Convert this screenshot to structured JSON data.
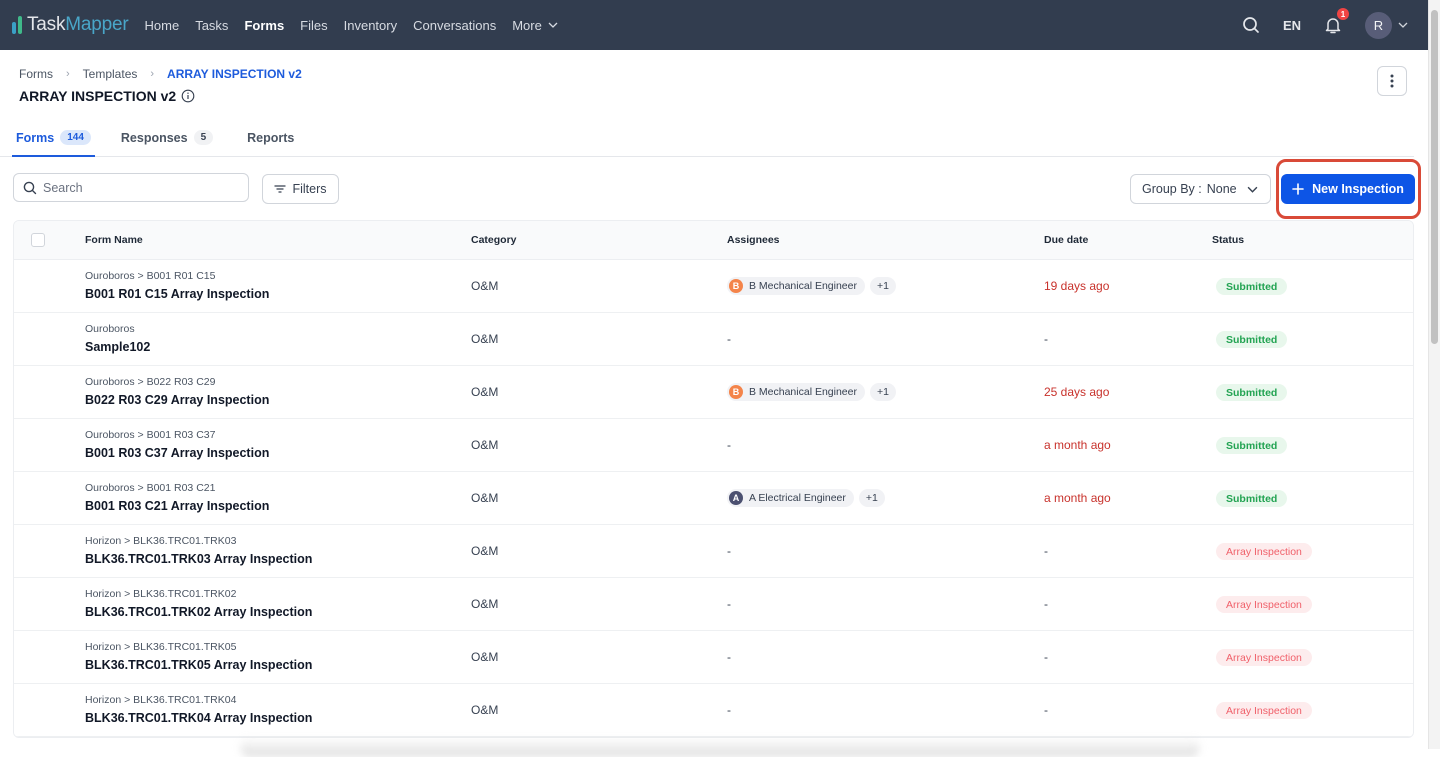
{
  "app": {
    "logo_part1": "Task",
    "logo_part2": "Mapper",
    "nav": [
      {
        "label": "Home",
        "active": false
      },
      {
        "label": "Tasks",
        "active": false
      },
      {
        "label": "Forms",
        "active": true
      },
      {
        "label": "Files",
        "active": false
      },
      {
        "label": "Inventory",
        "active": false
      },
      {
        "label": "Conversations",
        "active": false
      },
      {
        "label": "More",
        "active": false,
        "has_dropdown": true
      }
    ],
    "language": "EN",
    "notification_count": "1",
    "user_initial": "R",
    "icons": {
      "search": "search-icon",
      "bell": "bell-icon",
      "chevron": "chevron-down-icon"
    }
  },
  "breadcrumb": [
    {
      "label": "Forms"
    },
    {
      "label": "Templates"
    },
    {
      "label": "ARRAY INSPECTION v2",
      "current": true
    }
  ],
  "page": {
    "title": "ARRAY INSPECTION v2"
  },
  "tabs": [
    {
      "label": "Forms",
      "count": "144",
      "active": true
    },
    {
      "label": "Responses",
      "count": "5",
      "active": false
    },
    {
      "label": "Reports",
      "count": null,
      "active": false
    }
  ],
  "toolbar": {
    "search_placeholder": "Search",
    "search_value": "",
    "filters_label": "Filters",
    "group_by_label": "Group By :",
    "group_by_value": "None",
    "new_button_label": "New Inspection"
  },
  "colors": {
    "nav_bg": "#323d4f",
    "accent": "#0d55e6",
    "overdue": "#c8322c",
    "submitted_fg": "#22a352",
    "submitted_bg": "#e8f7ec",
    "array_fg": "#f0606a",
    "array_bg": "#fdeced",
    "highlight": "#d94a38"
  },
  "table": {
    "columns": [
      "Form Name",
      "Category",
      "Assignees",
      "Due date",
      "Status"
    ],
    "rows": [
      {
        "path": "Ouroboros > B001 R01 C15",
        "name": "B001 R01 C15 Array Inspection",
        "category": "O&M",
        "assignee": "B Mechanical Engineer",
        "assignee_initial": "B",
        "assignee_color": "#f4844a",
        "assignee_more": "+1",
        "due": "19 days ago",
        "overdue": true,
        "status": "Submitted",
        "status_type": "submitted"
      },
      {
        "path": "Ouroboros",
        "name": "Sample102",
        "category": "O&M",
        "assignee": "-",
        "assignee_initial": null,
        "assignee_color": null,
        "assignee_more": null,
        "due": "-",
        "overdue": false,
        "status": "Submitted",
        "status_type": "submitted"
      },
      {
        "path": "Ouroboros > B022 R03 C29",
        "name": "B022 R03 C29 Array Inspection",
        "category": "O&M",
        "assignee": "B Mechanical Engineer",
        "assignee_initial": "B",
        "assignee_color": "#f4844a",
        "assignee_more": "+1",
        "due": "25 days ago",
        "overdue": true,
        "status": "Submitted",
        "status_type": "submitted"
      },
      {
        "path": "Ouroboros > B001 R03 C37",
        "name": "B001 R03 C37 Array Inspection",
        "category": "O&M",
        "assignee": "-",
        "assignee_initial": null,
        "assignee_color": null,
        "assignee_more": null,
        "due": "a month ago",
        "overdue": true,
        "status": "Submitted",
        "status_type": "submitted"
      },
      {
        "path": "Ouroboros > B001 R03 C21",
        "name": "B001 R03 C21 Array Inspection",
        "category": "O&M",
        "assignee": "A Electrical Engineer",
        "assignee_initial": "A",
        "assignee_color": "#4b5070",
        "assignee_more": "+1",
        "due": "a month ago",
        "overdue": true,
        "status": "Submitted",
        "status_type": "submitted"
      },
      {
        "path": "Horizon > BLK36.TRC01.TRK03",
        "name": "BLK36.TRC01.TRK03 Array Inspection",
        "category": "O&M",
        "assignee": "-",
        "assignee_initial": null,
        "assignee_color": null,
        "assignee_more": null,
        "due": "-",
        "overdue": false,
        "status": "Array Inspection",
        "status_type": "array"
      },
      {
        "path": "Horizon > BLK36.TRC01.TRK02",
        "name": "BLK36.TRC01.TRK02 Array Inspection",
        "category": "O&M",
        "assignee": "-",
        "assignee_initial": null,
        "assignee_color": null,
        "assignee_more": null,
        "due": "-",
        "overdue": false,
        "status": "Array Inspection",
        "status_type": "array"
      },
      {
        "path": "Horizon > BLK36.TRC01.TRK05",
        "name": "BLK36.TRC01.TRK05 Array Inspection",
        "category": "O&M",
        "assignee": "-",
        "assignee_initial": null,
        "assignee_color": null,
        "assignee_more": null,
        "due": "-",
        "overdue": false,
        "status": "Array Inspection",
        "status_type": "array"
      },
      {
        "path": "Horizon > BLK36.TRC01.TRK04",
        "name": "BLK36.TRC01.TRK04 Array Inspection",
        "category": "O&M",
        "assignee": "-",
        "assignee_initial": null,
        "assignee_color": null,
        "assignee_more": null,
        "due": "-",
        "overdue": false,
        "status": "Array Inspection",
        "status_type": "array"
      }
    ]
  }
}
